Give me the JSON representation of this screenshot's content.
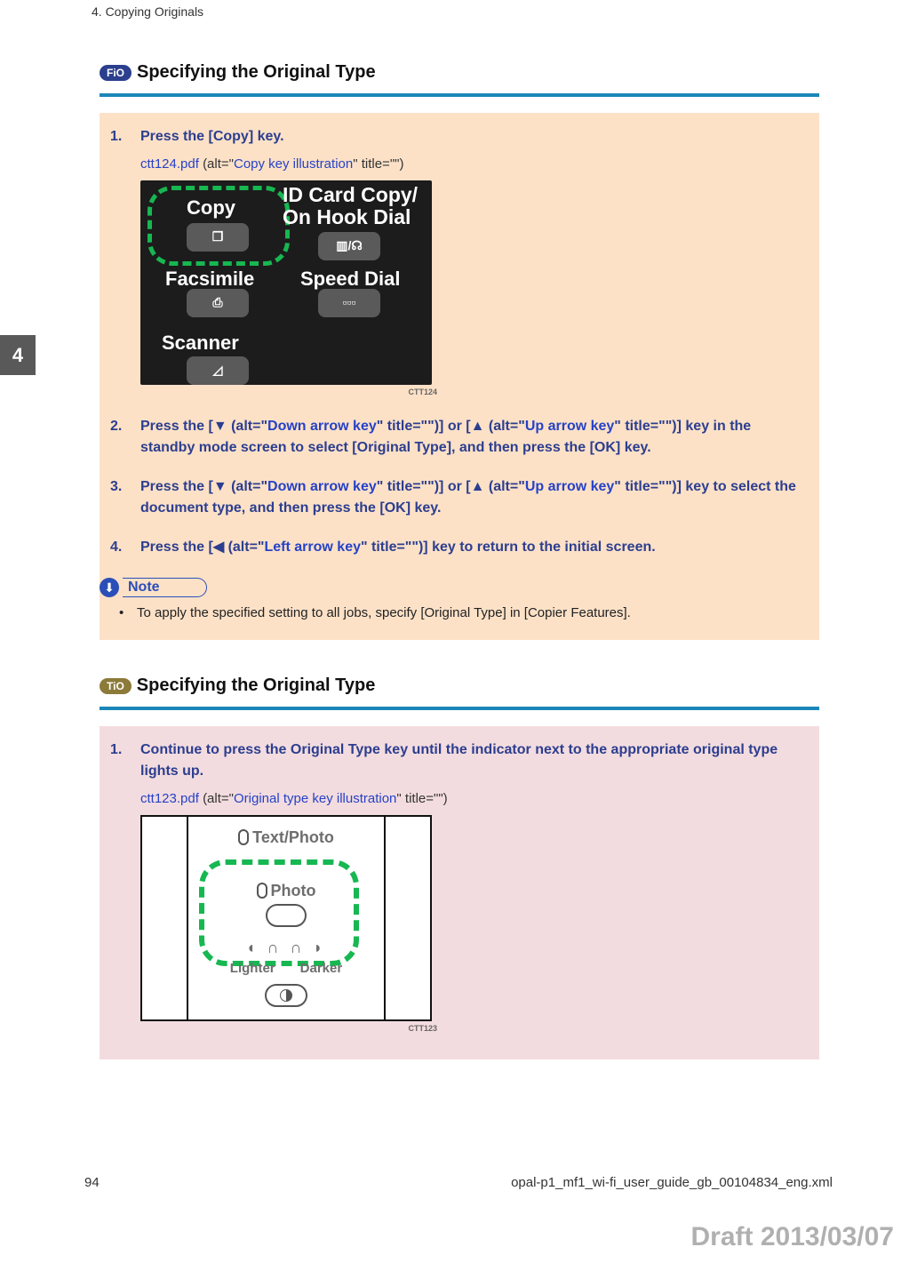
{
  "header": {
    "chapter": "4. Copying Originals"
  },
  "sideTab": "4",
  "sectionA": {
    "badge": "FiO",
    "title": "Specifying the Original Type",
    "steps": [
      {
        "text": "Press the [Copy] key."
      },
      {
        "text_parts": {
          "p1": "Press the [▼ (alt=\"",
          "link1": "Down arrow key",
          "p2": "\" title=\"\")] or [▲ (alt=\"",
          "link2": "Up arrow key",
          "p3": "\" title=\"\")] key in the standby mode screen to select [Original Type], and then press the [OK] key."
        }
      },
      {
        "text_parts": {
          "p1": "Press the [▼ (alt=\"",
          "link1": "Down arrow key",
          "p2": "\" title=\"\")] or [▲ (alt=\"",
          "link2": "Up arrow key",
          "p3": "\" title=\"\")] key to select the document type, and then press the [OK] key."
        }
      },
      {
        "text_parts": {
          "p1": "Press the [◀ (alt=\"",
          "link1": "Left arrow key",
          "p2": "\" title=\"\")] key to return to the initial screen."
        }
      }
    ],
    "fig1": {
      "caption_link": "ctt124.pdf",
      "caption_alt": "Copy key illustration",
      "caption_tail": "\" title=\"\")",
      "code": "CTT124",
      "labels": {
        "copy": "Copy",
        "fax": "Facsimile",
        "scanner": "Scanner",
        "idcard_l1": "ID Card Copy/",
        "idcard_l2": "On Hook Dial",
        "speed": "Speed Dial"
      }
    },
    "note": {
      "label": "Note",
      "items": [
        "To apply the specified setting to all jobs, specify [Original Type] in [Copier Features]."
      ]
    }
  },
  "sectionB": {
    "badge": "TiO",
    "title": "Specifying the Original Type",
    "steps": [
      {
        "text": "Continue to press the Original Type key until the indicator next to the appropriate original type lights up."
      }
    ],
    "fig2": {
      "caption_link": "ctt123.pdf",
      "caption_alt": "Original type key illustration",
      "caption_tail": "\" title=\"\")",
      "code": "CTT123",
      "labels": {
        "textphoto": "Text/Photo",
        "photo": "Photo",
        "lighter": "Lighter",
        "darker": "Darker"
      }
    }
  },
  "footer": {
    "page": "94",
    "file": "opal-p1_mf1_wi-fi_user_guide_gb_00104834_eng.xml",
    "draft": "Draft 2013/03/07"
  }
}
